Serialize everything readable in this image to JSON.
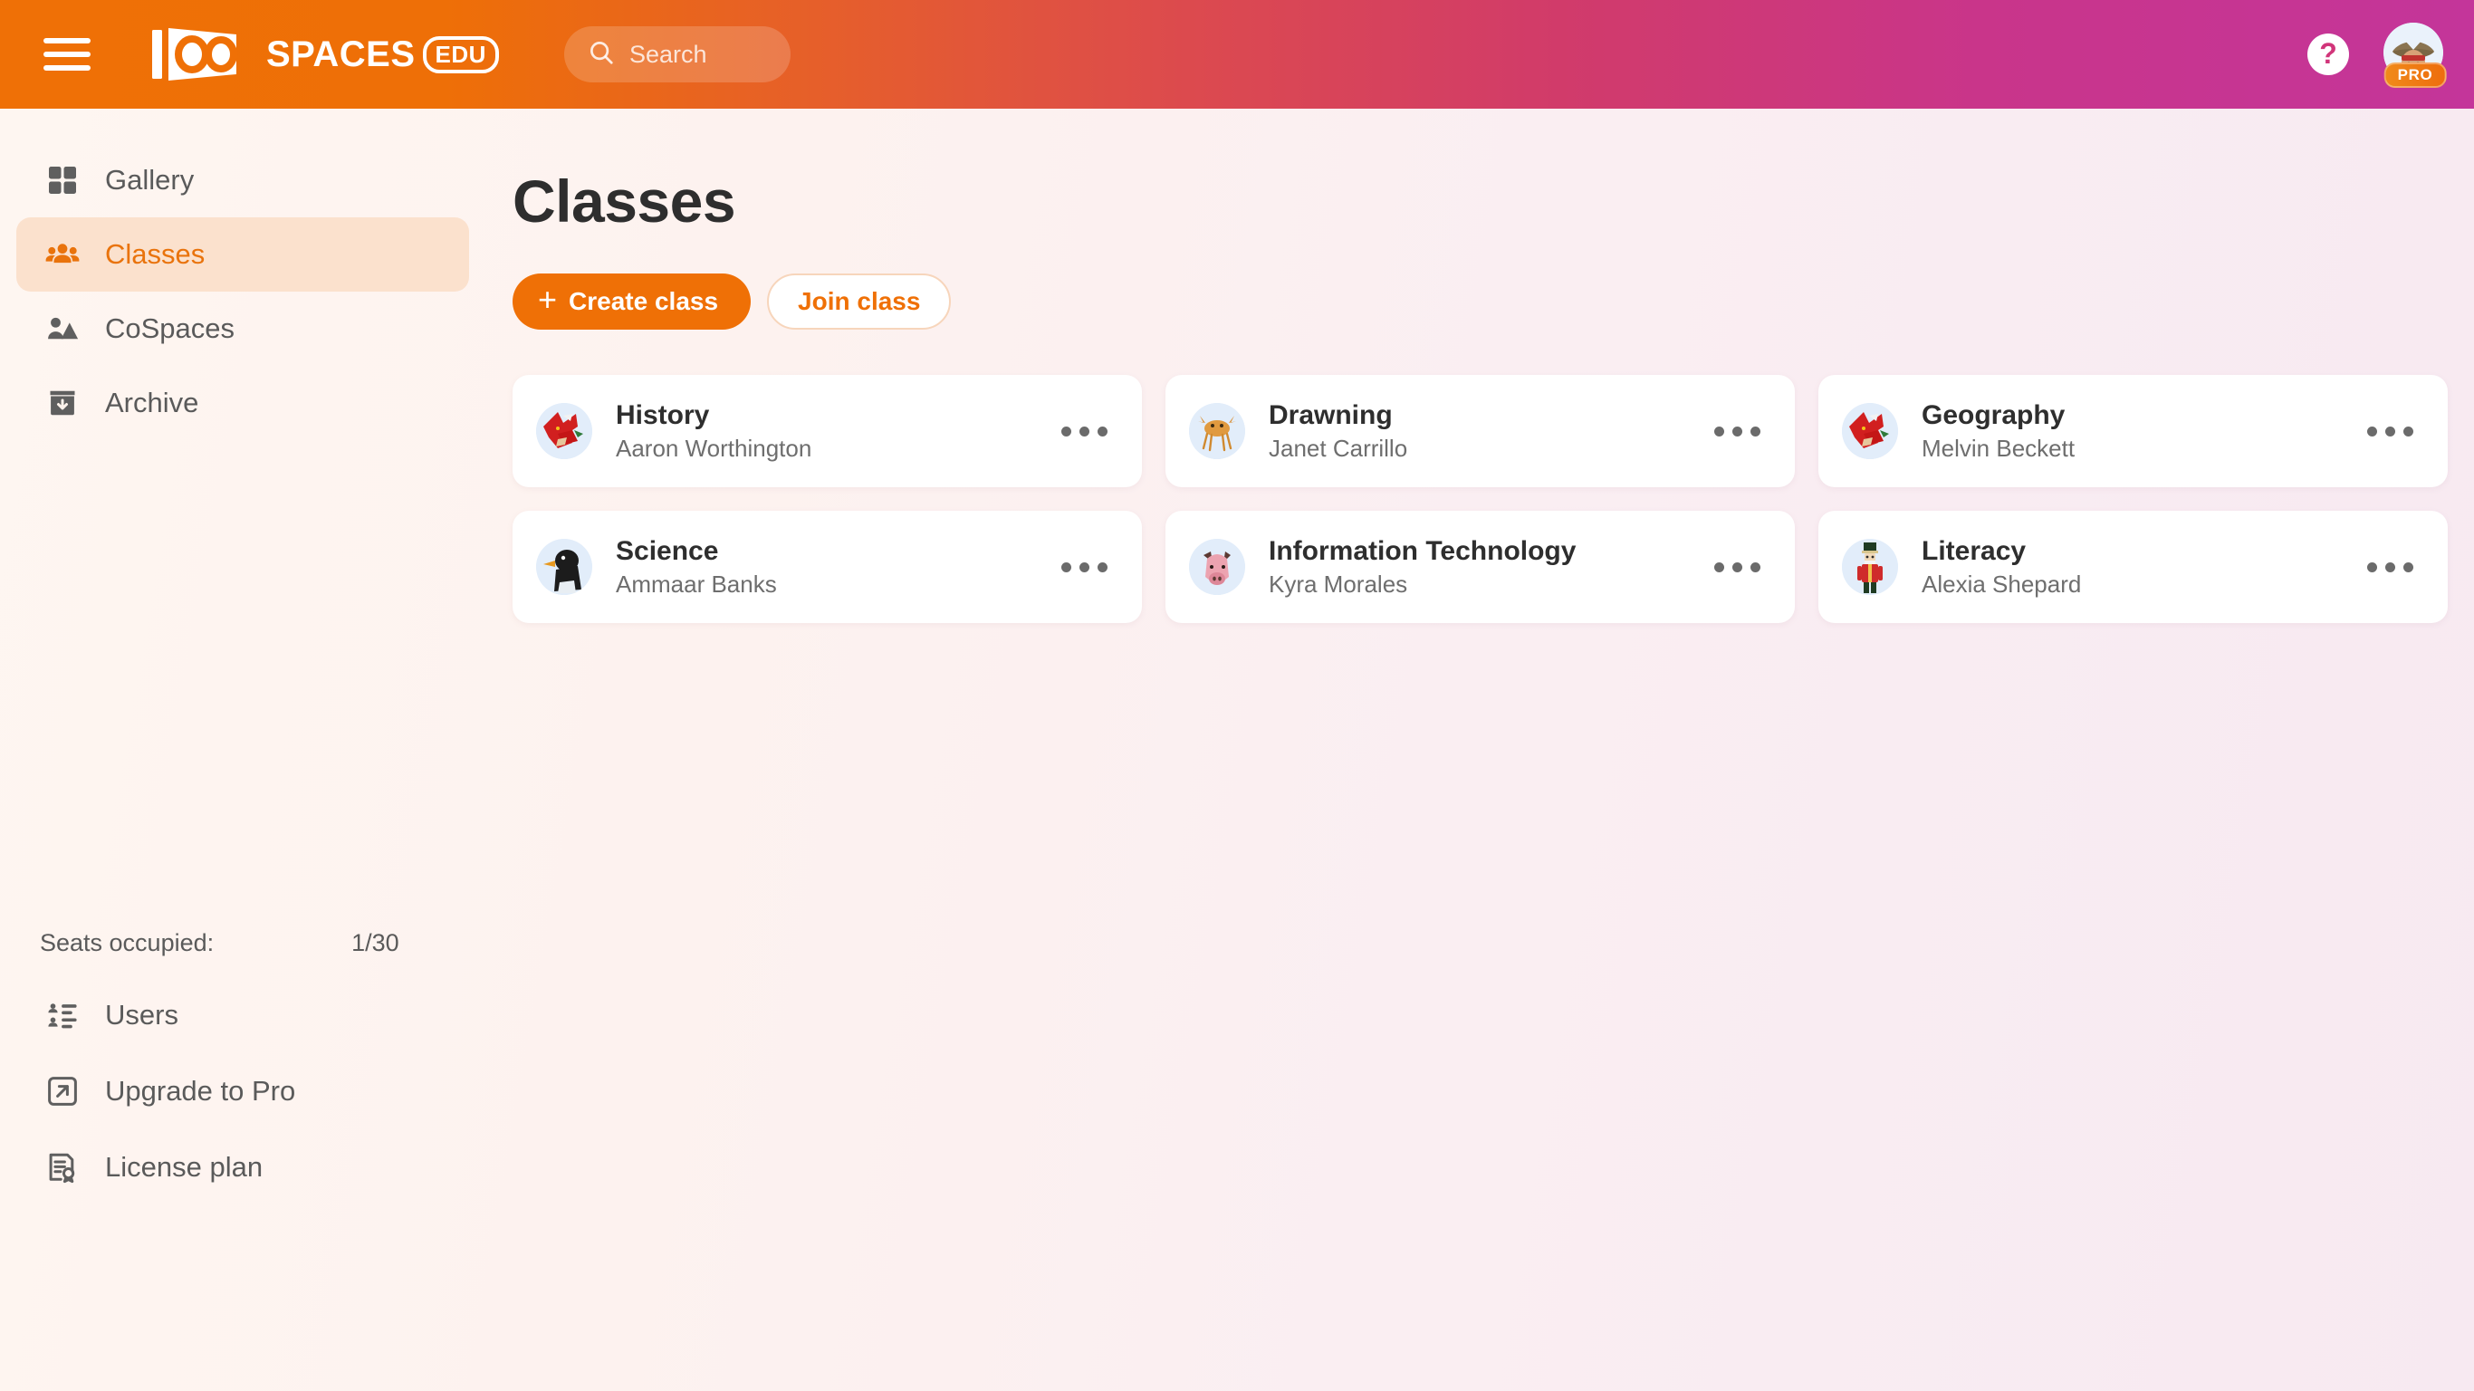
{
  "header": {
    "menu_icon": "hamburger-menu-icon",
    "logo": {
      "mark": "CO",
      "text": "SPACES",
      "badge": "EDU"
    },
    "search": {
      "placeholder": "Search",
      "value": "",
      "icon": "search-icon"
    },
    "help_label": "?",
    "account": {
      "badge": "PRO",
      "avatar": "pirate-avatar"
    },
    "gradient_from": "#ef7006",
    "gradient_to": "#c9358a"
  },
  "sidebar": {
    "items": [
      {
        "label": "Gallery",
        "icon": "grid-icon",
        "active": false
      },
      {
        "label": "Classes",
        "icon": "people-group-icon",
        "active": true
      },
      {
        "label": "CoSpaces",
        "icon": "person-landscape-icon",
        "active": false
      },
      {
        "label": "Archive",
        "icon": "archive-box-icon",
        "active": false
      }
    ],
    "seats": {
      "label": "Seats occupied:",
      "value": "1/30"
    },
    "bottom_items": [
      {
        "label": "Users",
        "icon": "users-list-icon"
      },
      {
        "label": "Upgrade to Pro",
        "icon": "external-link-icon"
      },
      {
        "label": "License plan",
        "icon": "license-document-icon"
      }
    ],
    "active_bg": "#fbe1cd",
    "active_color": "#e9730c"
  },
  "main": {
    "title": "Classes",
    "create_button": {
      "plus": "+",
      "label": "Create class"
    },
    "join_button": {
      "label": "Join class"
    },
    "menu_icon": "three-dots-icon",
    "classes": [
      {
        "name": "History",
        "teacher": "Aaron Worthington",
        "avatar": "red-dragon-avatar"
      },
      {
        "name": "Drawning",
        "teacher": "Janet Carrillo",
        "avatar": "crab-avatar"
      },
      {
        "name": "Geography",
        "teacher": "Melvin Beckett",
        "avatar": "red-dragon-avatar"
      },
      {
        "name": "Science",
        "teacher": "Ammaar Banks",
        "avatar": "penguin-avatar"
      },
      {
        "name": "Information Technology",
        "teacher": "Kyra Morales",
        "avatar": "pig-avatar"
      },
      {
        "name": "Literacy",
        "teacher": "Alexia Shepard",
        "avatar": "nutcracker-avatar"
      }
    ]
  },
  "colors": {
    "accent_orange": "#ef7006",
    "accent_magenta": "#c9358a",
    "page_bg_left": "#fef6f1",
    "page_bg_right": "#f7e9f1",
    "card_bg": "#ffffff",
    "text_dark": "#2e2e2e",
    "text_muted": "#6e6e6e"
  }
}
